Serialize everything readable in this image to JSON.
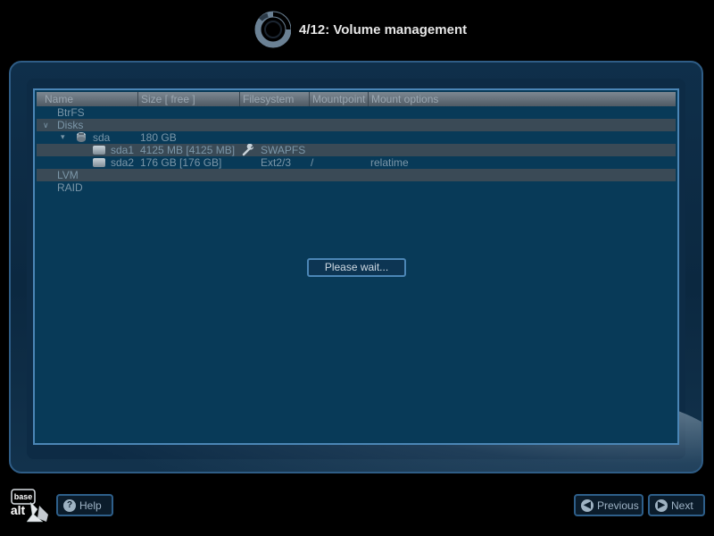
{
  "header": {
    "title": "4/12: Volume management"
  },
  "columns": [
    "Name",
    "Size [ free ]",
    "Filesystem",
    "Mountpoint",
    "Mount options"
  ],
  "tree": [
    {
      "name": "BtrFS",
      "size": "",
      "fs": "",
      "mount": "",
      "options": ""
    },
    {
      "name": "Disks",
      "size": "",
      "fs": "",
      "mount": "",
      "options": ""
    },
    {
      "name": "sda",
      "size": "180 GB",
      "fs": "",
      "mount": "",
      "options": ""
    },
    {
      "name": "sda1",
      "size": "4125 MB [4125 MB]",
      "fs": "SWAPFS",
      "mount": "",
      "options": ""
    },
    {
      "name": "sda2",
      "size": "176 GB [176 GB]",
      "fs": "Ext2/3",
      "mount": "/",
      "options": "relatime"
    },
    {
      "name": "LVM",
      "size": "",
      "fs": "",
      "mount": "",
      "options": ""
    },
    {
      "name": "RAID",
      "size": "",
      "fs": "",
      "mount": "",
      "options": ""
    }
  ],
  "status": {
    "wait_label": "Please wait..."
  },
  "footer": {
    "logo_text_top": "base",
    "logo_text_bottom": "alt",
    "help_label": "Help",
    "previous_label": "Previous",
    "next_label": "Next"
  }
}
